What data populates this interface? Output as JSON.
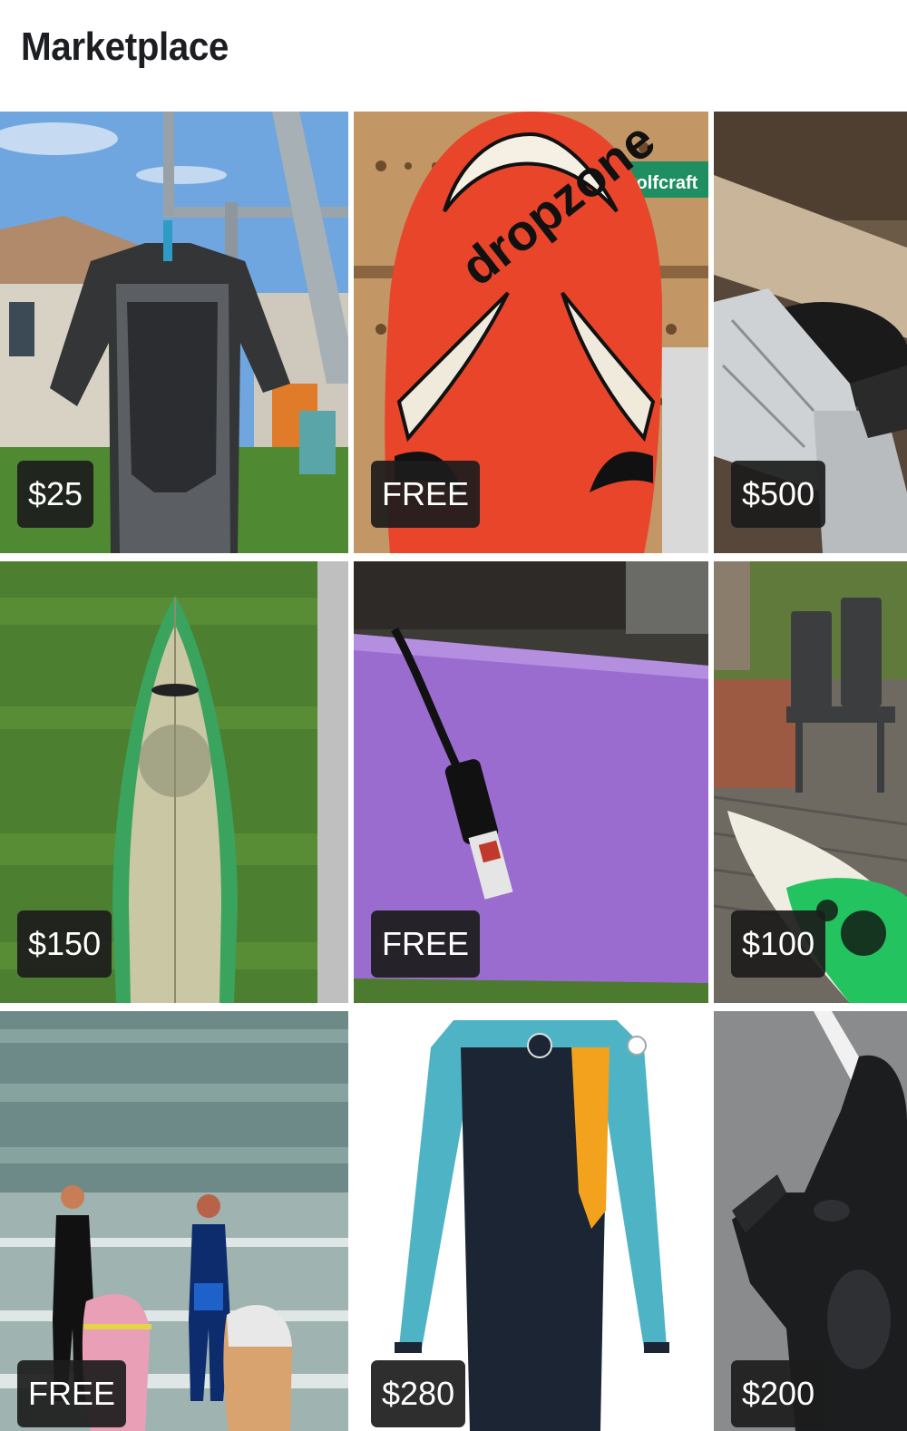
{
  "header": {
    "title": "Marketplace"
  },
  "listings": [
    {
      "price": "$25",
      "image": "black-wetshirt-on-clothesline"
    },
    {
      "price": "FREE",
      "image": "red-dropzone-bodyboard"
    },
    {
      "price": "$500",
      "image": "car-gearbox-parts"
    },
    {
      "price": "$150",
      "image": "green-surfboard-on-grass"
    },
    {
      "price": "FREE",
      "image": "purple-softboard-with-leash"
    },
    {
      "price": "$100",
      "image": "deck-chairs-and-surfboard"
    },
    {
      "price": "FREE",
      "image": "two-surfers-entering-sea"
    },
    {
      "price": "$280",
      "image": "teal-black-wetsuit"
    },
    {
      "price": "$200",
      "image": "black-wetsuit-on-road"
    }
  ]
}
